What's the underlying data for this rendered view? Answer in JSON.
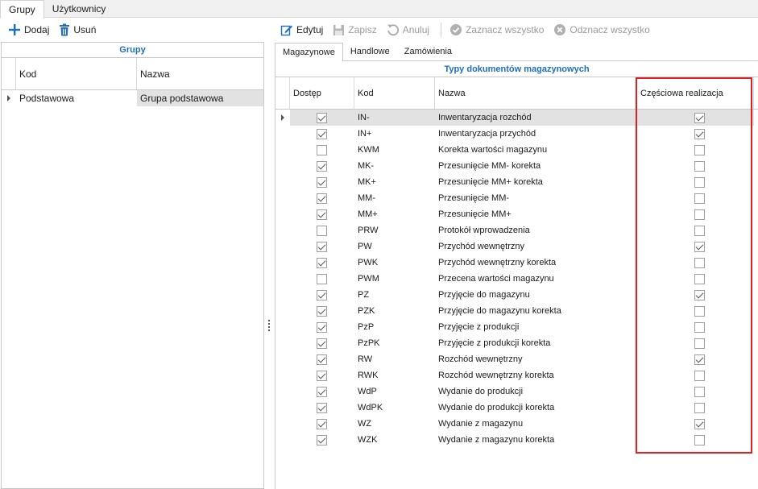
{
  "top_tabs": [
    {
      "label": "Grupy",
      "active": true
    },
    {
      "label": "Użytkownicy",
      "active": false
    }
  ],
  "left_toolbar": {
    "add_label": "Dodaj",
    "delete_label": "Usuń"
  },
  "right_toolbar": {
    "edit_label": "Edytuj",
    "save_label": "Zapisz",
    "cancel_label": "Anuluj",
    "select_all_label": "Zaznacz wszystko",
    "deselect_all_label": "Odznacz wszystko"
  },
  "groups_panel": {
    "title": "Grupy",
    "columns": {
      "kod": "Kod",
      "nazwa": "Nazwa"
    },
    "rows": [
      {
        "kod": "Podstawowa",
        "nazwa": "Grupa podstawowa"
      }
    ]
  },
  "sub_tabs": [
    {
      "label": "Magazynowe",
      "active": true
    },
    {
      "label": "Handlowe",
      "active": false
    },
    {
      "label": "Zamówienia",
      "active": false
    }
  ],
  "doc_types_panel": {
    "title": "Typy dokumentów magazynowych",
    "columns": {
      "dostep": "Dostęp",
      "kod": "Kod",
      "nazwa": "Nazwa",
      "czesciowa": "Częściowa realizacja"
    },
    "rows": [
      {
        "kod": "IN-",
        "nazwa": "Inwentaryzacja rozchód",
        "dostep": true,
        "czesciowa": true
      },
      {
        "kod": "IN+",
        "nazwa": "Inwentaryzacja przychód",
        "dostep": true,
        "czesciowa": true
      },
      {
        "kod": "KWM",
        "nazwa": "Korekta wartości magazynu",
        "dostep": false,
        "czesciowa": false
      },
      {
        "kod": "MK-",
        "nazwa": "Przesunięcie MM- korekta",
        "dostep": true,
        "czesciowa": false
      },
      {
        "kod": "MK+",
        "nazwa": "Przesunięcie MM+ korekta",
        "dostep": true,
        "czesciowa": false
      },
      {
        "kod": "MM-",
        "nazwa": "Przesunięcie MM-",
        "dostep": true,
        "czesciowa": false
      },
      {
        "kod": "MM+",
        "nazwa": "Przesunięcie MM+",
        "dostep": true,
        "czesciowa": false
      },
      {
        "kod": "PRW",
        "nazwa": "Protokół wprowadzenia",
        "dostep": false,
        "czesciowa": false
      },
      {
        "kod": "PW",
        "nazwa": "Przychód wewnętrzny",
        "dostep": true,
        "czesciowa": true
      },
      {
        "kod": "PWK",
        "nazwa": "Przychód wewnętrzny korekta",
        "dostep": true,
        "czesciowa": false
      },
      {
        "kod": "PWM",
        "nazwa": "Przecena wartości magazynu",
        "dostep": false,
        "czesciowa": false
      },
      {
        "kod": "PZ",
        "nazwa": "Przyjęcie do magazynu",
        "dostep": true,
        "czesciowa": true
      },
      {
        "kod": "PZK",
        "nazwa": "Przyjęcie do magazynu korekta",
        "dostep": true,
        "czesciowa": false
      },
      {
        "kod": "PzP",
        "nazwa": "Przyjęcie z produkcji",
        "dostep": true,
        "czesciowa": false
      },
      {
        "kod": "PzPK",
        "nazwa": "Przyjęcie z produkcji korekta",
        "dostep": true,
        "czesciowa": false
      },
      {
        "kod": "RW",
        "nazwa": "Rozchód wewnętrzny",
        "dostep": true,
        "czesciowa": true
      },
      {
        "kod": "RWK",
        "nazwa": "Rozchód wewnętrzny korekta",
        "dostep": true,
        "czesciowa": false
      },
      {
        "kod": "WdP",
        "nazwa": "Wydanie do produkcji",
        "dostep": true,
        "czesciowa": false
      },
      {
        "kod": "WdPK",
        "nazwa": "Wydanie do produkcji korekta",
        "dostep": true,
        "czesciowa": false
      },
      {
        "kod": "WZ",
        "nazwa": "Wydanie z magazynu",
        "dostep": true,
        "czesciowa": true
      },
      {
        "kod": "WZK",
        "nazwa": "Wydanie z magazynu korekta",
        "dostep": true,
        "czesciowa": false
      }
    ]
  },
  "colors": {
    "accent": "#1f6fbf",
    "highlight": "#e02020",
    "selection": "#e2e2e2"
  }
}
